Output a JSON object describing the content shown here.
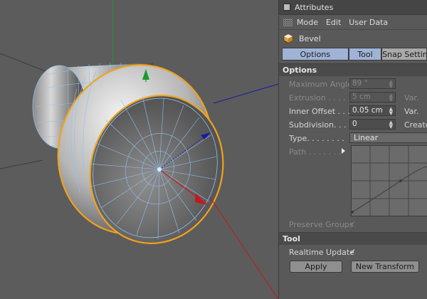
{
  "panel": {
    "title": "Attributes",
    "menu": [
      "Mode",
      "Edit",
      "User Data"
    ],
    "object_name": "Bevel",
    "tabs": [
      "Options",
      "Tool",
      "Snap Settings"
    ],
    "options_section": "Options",
    "fields": {
      "maximum_angle": {
        "label": "Maximum Angle",
        "value": "89 °"
      },
      "extrusion": {
        "label": "Extrusion . . . . .",
        "value": "5 cm",
        "var": "Var."
      },
      "inner_offset": {
        "label": "Inner Offset  . . .",
        "value": "0.05 cm",
        "var": "Var."
      },
      "subdivision": {
        "label": "Subdivision. . . .",
        "value": "0",
        "var": "Create"
      },
      "type": {
        "label": "Type. . . . . . . .",
        "value": "Linear"
      },
      "path": {
        "label": "Path . . . . . . ."
      },
      "preserve_groups": {
        "label": "Preserve Groups"
      }
    },
    "tool_section": "Tool",
    "realtime_update": {
      "label": "Realtime Update"
    },
    "buttons": {
      "apply": "Apply",
      "new_transform": "New Transform"
    }
  },
  "colors": {
    "viewport_bg": "#5c5c5c",
    "selection_edge": "#f2a21c",
    "wire": "#8fc2f0",
    "axis_x": "#c8171d",
    "axis_y": "#1c9a2e",
    "axis_z": "#1a1aa0",
    "tab_active": "#9fb3d6"
  }
}
